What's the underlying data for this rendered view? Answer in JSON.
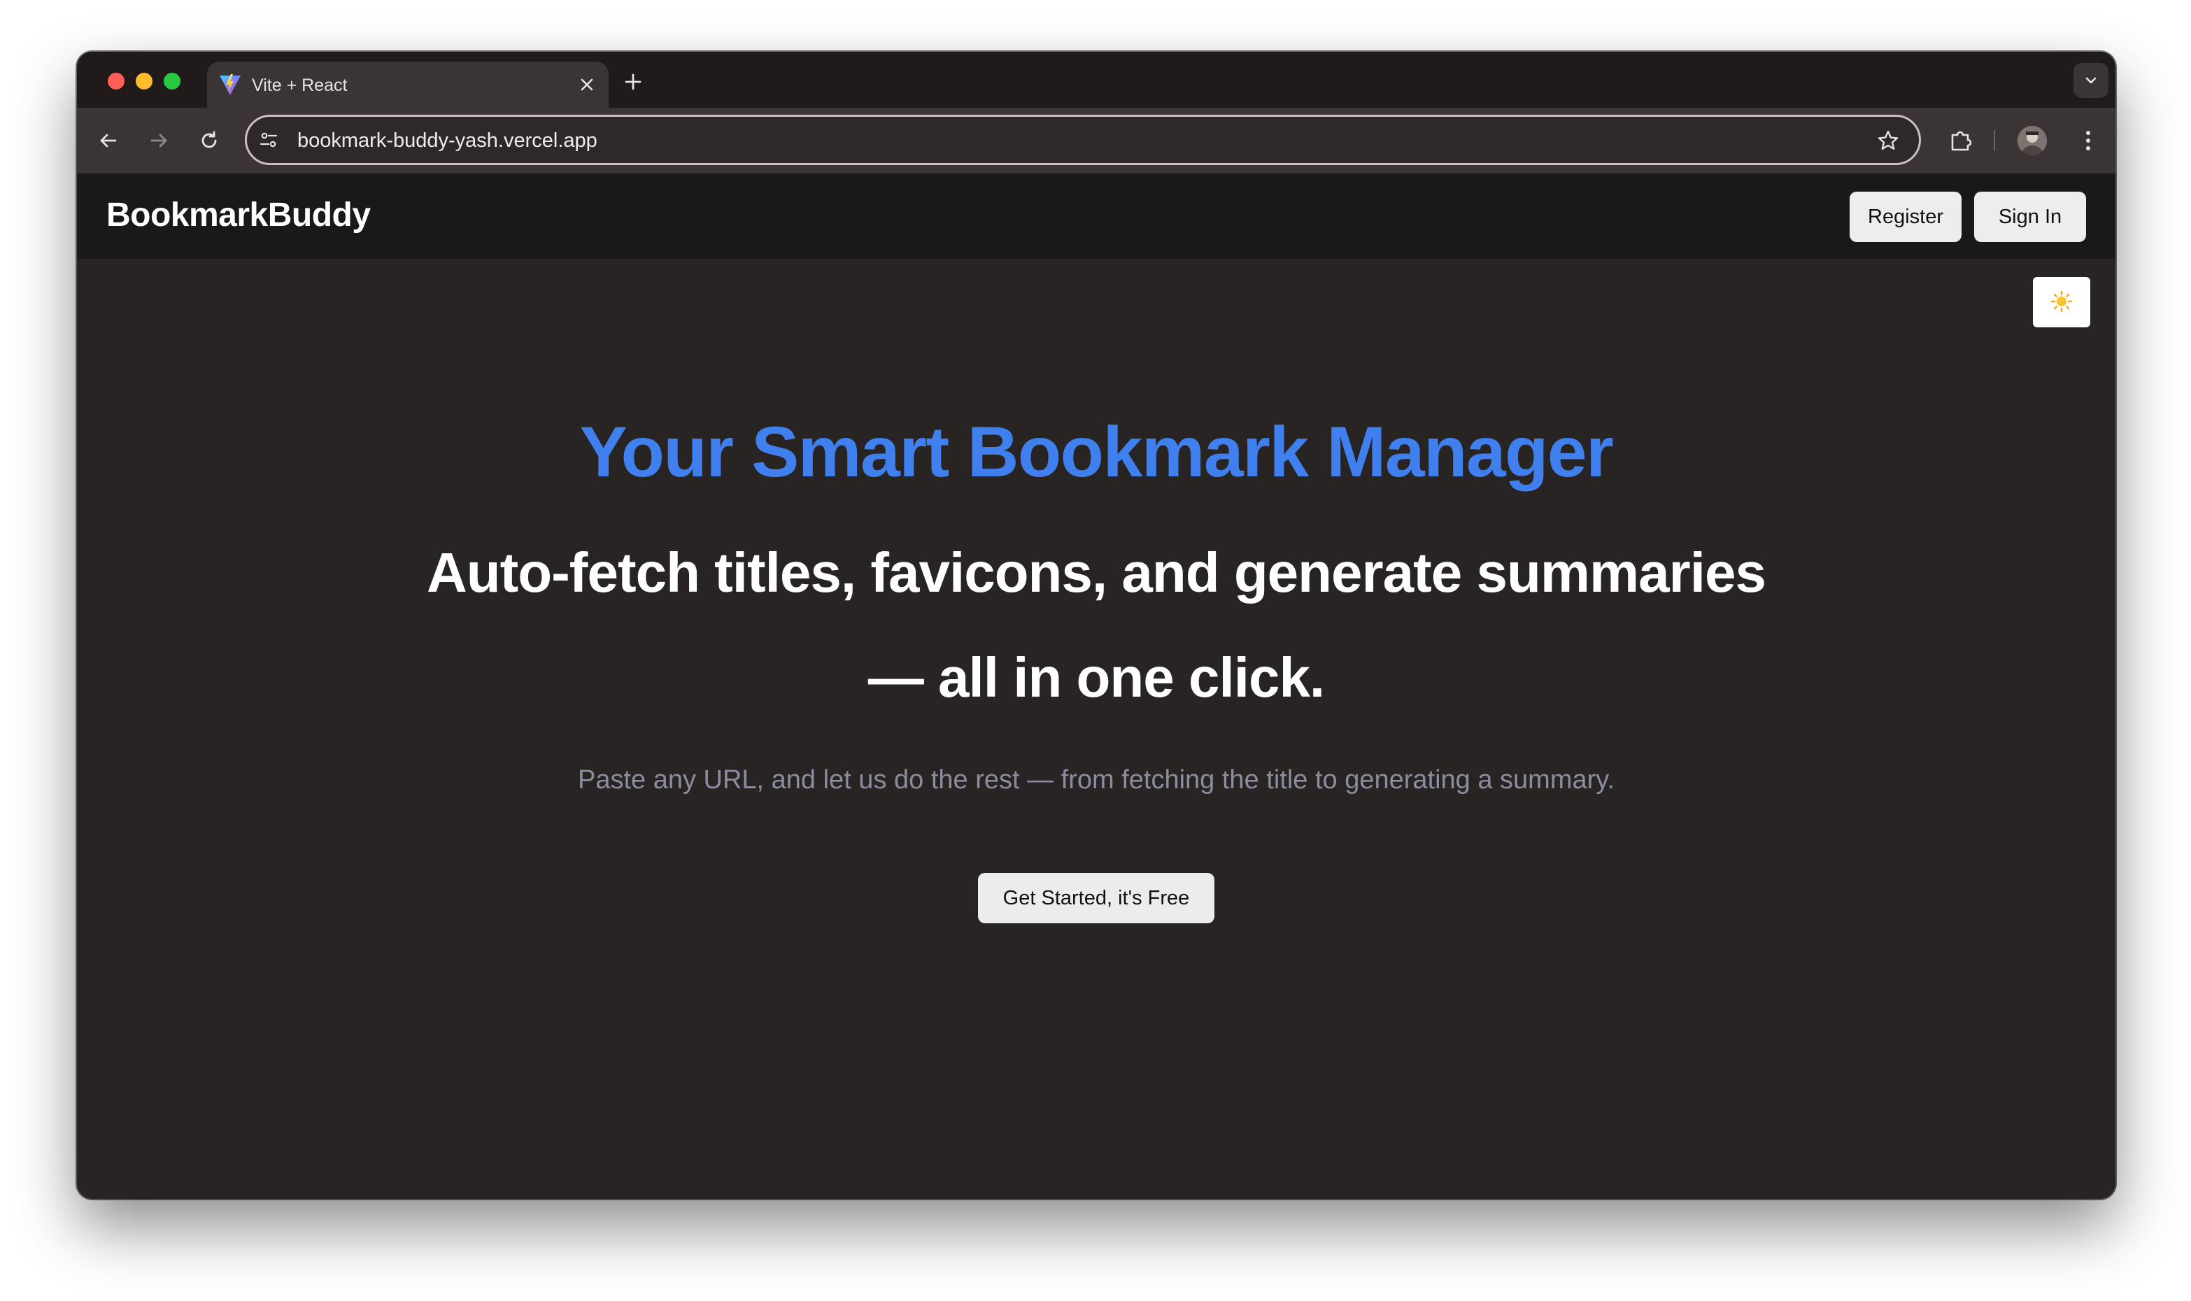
{
  "browser": {
    "tab_title": "Vite + React",
    "url": "bookmark-buddy-yash.vercel.app"
  },
  "site": {
    "brand": "BookmarkBuddy",
    "register_label": "Register",
    "signin_label": "Sign In",
    "theme_toggle_icon": "☀️"
  },
  "hero": {
    "title": "Your Smart Bookmark Manager",
    "subtitle_line1": "Auto-fetch titles, favicons, and generate summaries",
    "subtitle_line2": "— all in one click.",
    "description": "Paste any URL, and let us do the rest — from fetching the title to generating a summary.",
    "cta_label": "Get Started, it's Free"
  },
  "colors": {
    "accent": "#4080ee",
    "page_bg": "#282423",
    "header_bg": "#1b1918"
  }
}
